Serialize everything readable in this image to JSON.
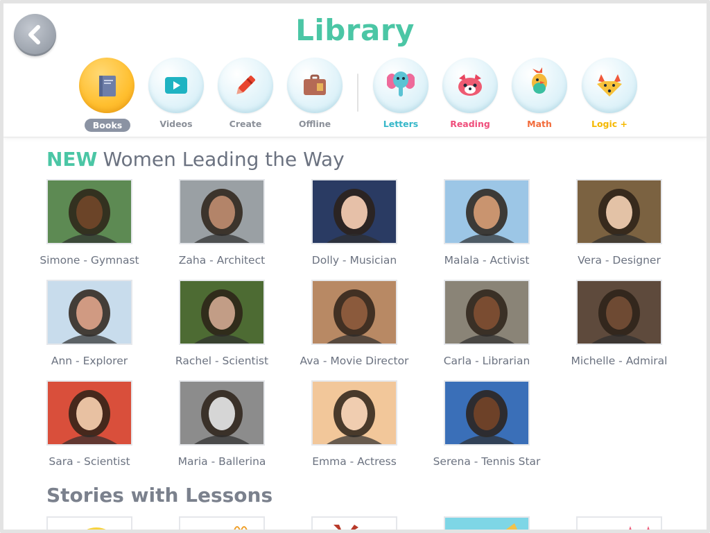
{
  "app": {
    "title": "Library"
  },
  "nav": [
    {
      "label": "Books",
      "icon": "book-icon",
      "active": true,
      "label_color": "#ffffff"
    },
    {
      "label": "Videos",
      "icon": "video-play-icon",
      "active": false,
      "label_color": "#8b9099"
    },
    {
      "label": "Create",
      "icon": "crayon-icon",
      "active": false,
      "label_color": "#8b9099"
    },
    {
      "label": "Offline",
      "icon": "suitcase-icon",
      "active": false,
      "label_color": "#8b9099"
    },
    {
      "label": "Letters",
      "icon": "elephant-icon",
      "active": false,
      "label_color": "#35b7c9"
    },
    {
      "label": "Reading",
      "icon": "red-panda-icon",
      "active": false,
      "label_color": "#ef4e7b"
    },
    {
      "label": "Math",
      "icon": "bird-icon",
      "active": false,
      "label_color": "#f26b3a"
    },
    {
      "label": "Logic +",
      "icon": "fox-icon",
      "active": false,
      "label_color": "#f5b800"
    }
  ],
  "sections": {
    "women": {
      "badge": "NEW",
      "title": "Women Leading the Way",
      "items": [
        {
          "label": "Simone - Gymnast",
          "bg": "#5d8a53",
          "skin": "#6b4428"
        },
        {
          "label": "Zaha - Architect",
          "bg": "#9aa0a4",
          "skin": "#b38469"
        },
        {
          "label": "Dolly - Musician",
          "bg": "#2a3b63",
          "skin": "#e6c0a8"
        },
        {
          "label": "Malala - Activist",
          "bg": "#9cc6e6",
          "skin": "#c9946f"
        },
        {
          "label": "Vera - Designer",
          "bg": "#7b6241",
          "skin": "#e3c2a6"
        },
        {
          "label": "Ann - Explorer",
          "bg": "#c8dcec",
          "skin": "#d09a82"
        },
        {
          "label": "Rachel - Scientist",
          "bg": "#4d6b33",
          "skin": "#c29d86"
        },
        {
          "label": "Ava - Movie Director",
          "bg": "#b88964",
          "skin": "#8b5a3c"
        },
        {
          "label": "Carla - Librarian",
          "bg": "#8a8477",
          "skin": "#7a4c31"
        },
        {
          "label": "Michelle - Admiral",
          "bg": "#5e4a3c",
          "skin": "#6e4a33"
        },
        {
          "label": "Sara - Scientist",
          "bg": "#d94f3b",
          "skin": "#e8c1a2"
        },
        {
          "label": "Maria - Ballerina",
          "bg": "#8c8c8c",
          "skin": "#d6d6d6"
        },
        {
          "label": "Emma - Actress",
          "bg": "#f2c79a",
          "skin": "#f0cdb0"
        },
        {
          "label": "Serena - Tennis Star",
          "bg": "#3a6fb8",
          "skin": "#6d4128"
        }
      ]
    },
    "lessons": {
      "title": "Stories with Lessons"
    }
  }
}
